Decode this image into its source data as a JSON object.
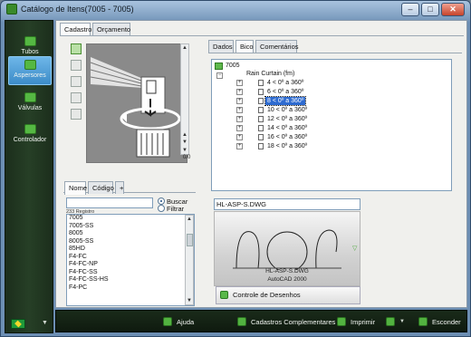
{
  "window": {
    "title": "Catálogo de Itens(7005 - 7005)",
    "controls": [
      "–",
      "□",
      "✕"
    ]
  },
  "sidebar": {
    "items": [
      {
        "label": "Tubos",
        "icon": "pipe-icon",
        "active": false
      },
      {
        "label": "Aspersores",
        "icon": "sprinkler-icon",
        "active": true
      },
      {
        "label": "Válvulas",
        "icon": "valve-icon",
        "active": false
      },
      {
        "label": "Controlador",
        "icon": "controller-icon",
        "active": false
      }
    ],
    "language_flag": "brazil-flag-icon"
  },
  "top_tabs": [
    {
      "label": "Cadastro",
      "active": true
    },
    {
      "label": "Orçamento",
      "active": false
    }
  ],
  "preview": {
    "counter": "0/0"
  },
  "search": {
    "tabs": [
      {
        "label": "Nome",
        "active": true
      },
      {
        "label": "Código",
        "active": false
      },
      {
        "label": "+",
        "active": false
      }
    ],
    "value": "",
    "options": [
      {
        "label": "Buscar",
        "checked": true
      },
      {
        "label": "Filtrar",
        "checked": false
      }
    ],
    "record_count": "233 Registro"
  },
  "item_list": [
    "7005",
    "7005-SS",
    "8005",
    "8005-SS",
    "85HD",
    "F4-FC",
    "F4-FC-NP",
    "F4-FC-SS",
    "F4-FC-SS-HS",
    "F4-PC"
  ],
  "right_tabs": [
    {
      "label": "Dados",
      "active": false
    },
    {
      "label": "Bico",
      "active": true
    },
    {
      "label": "Comentários",
      "active": false
    }
  ],
  "tree": {
    "root": "7005",
    "group": "Rain Curtain (fm)",
    "nodes": [
      "4 < 0º a 360º",
      "6 < 0º a 360º",
      "8 < 0º a 360º",
      "10 < 0º a 360º",
      "12 < 0º a 360º",
      "14 < 0º a 360º",
      "16 < 0º a 360º",
      "18 < 0º a 360º"
    ],
    "selected_index": 2
  },
  "drawing": {
    "field_value": "HL-ASP-S.DWG",
    "caption_name": "HL-ASP-S.DWG",
    "caption_format": "AutoCAD 2000"
  },
  "controle_button": "Controle de Desenhos",
  "bottom_bar": {
    "ajuda": "Ajuda",
    "cadastros": "Cadastros Complementares",
    "imprimir": "Imprimir",
    "esconder": "Esconder"
  },
  "colors": {
    "accent_green": "#52b240",
    "sidebar_bg": "#1c2e1c",
    "selection": "#2e6bd0",
    "active_tab_blue": "#3c8cc8"
  }
}
